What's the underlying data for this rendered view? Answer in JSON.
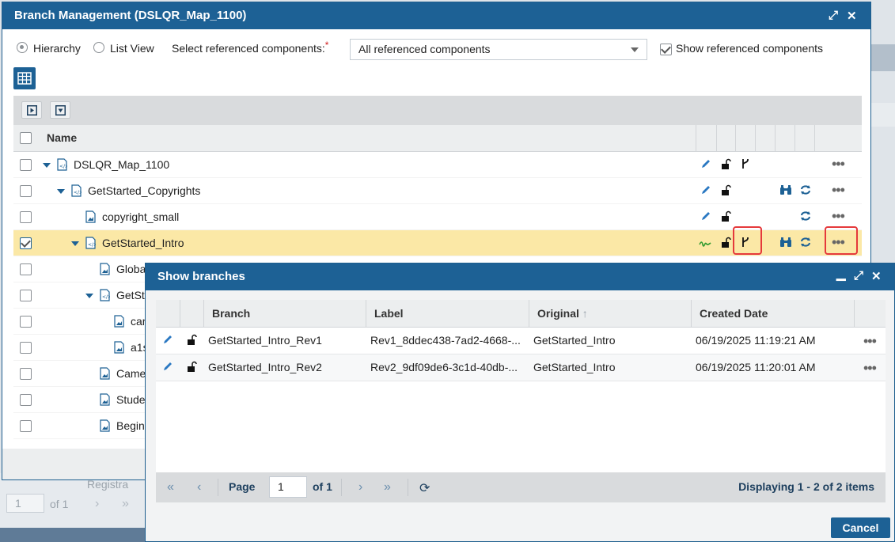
{
  "background": {
    "pager_page": "1",
    "pager_of": "of 1",
    "partial_item": "Registra"
  },
  "window": {
    "title": "Branch Management (DSLQR_Map_1100)",
    "view_hierarchy": "Hierarchy",
    "view_list": "List View",
    "select_label": "Select referenced components:",
    "required_mark": "*",
    "select_value": "All referenced components",
    "show_referenced": "Show referenced components",
    "name_header": "Name",
    "rows": [
      {
        "name": "DSLQR_Map_1100",
        "type": "map"
      },
      {
        "name": "GetStarted_Copyrights",
        "type": "map"
      },
      {
        "name": "copyright_small",
        "type": "image"
      },
      {
        "name": "GetStarted_Intro",
        "type": "map"
      },
      {
        "name": "Globa",
        "type": "image"
      },
      {
        "name": "GetSt",
        "type": "map"
      },
      {
        "name": "car",
        "type": "image"
      },
      {
        "name": "a1s",
        "type": "image"
      },
      {
        "name": "Came",
        "type": "image"
      },
      {
        "name": "Stude",
        "type": "image"
      },
      {
        "name": "Begin",
        "type": "image"
      }
    ]
  },
  "dialog": {
    "title": "Show branches",
    "columns": {
      "branch": "Branch",
      "label": "Label",
      "original": "Original",
      "created": "Created Date"
    },
    "rows": [
      {
        "branch": "GetStarted_Intro_Rev1",
        "label": "Rev1_8ddec438-7ad2-4668-...",
        "original": "GetStarted_Intro",
        "created": "06/19/2025 11:19:21 AM"
      },
      {
        "branch": "GetStarted_Intro_Rev2",
        "label": "Rev2_9df09de6-3c1d-40db-...",
        "original": "GetStarted_Intro",
        "created": "06/19/2025 11:20:01 AM"
      }
    ],
    "pager": {
      "page_label": "Page",
      "page_value": "1",
      "of_label": "of 1",
      "display": "Displaying 1 - 2 of 2 items"
    },
    "cancel": "Cancel"
  },
  "colors": {
    "titlebar": "#1d6195",
    "selected_row": "#fbe8a6",
    "highlight": "#e5393b"
  }
}
